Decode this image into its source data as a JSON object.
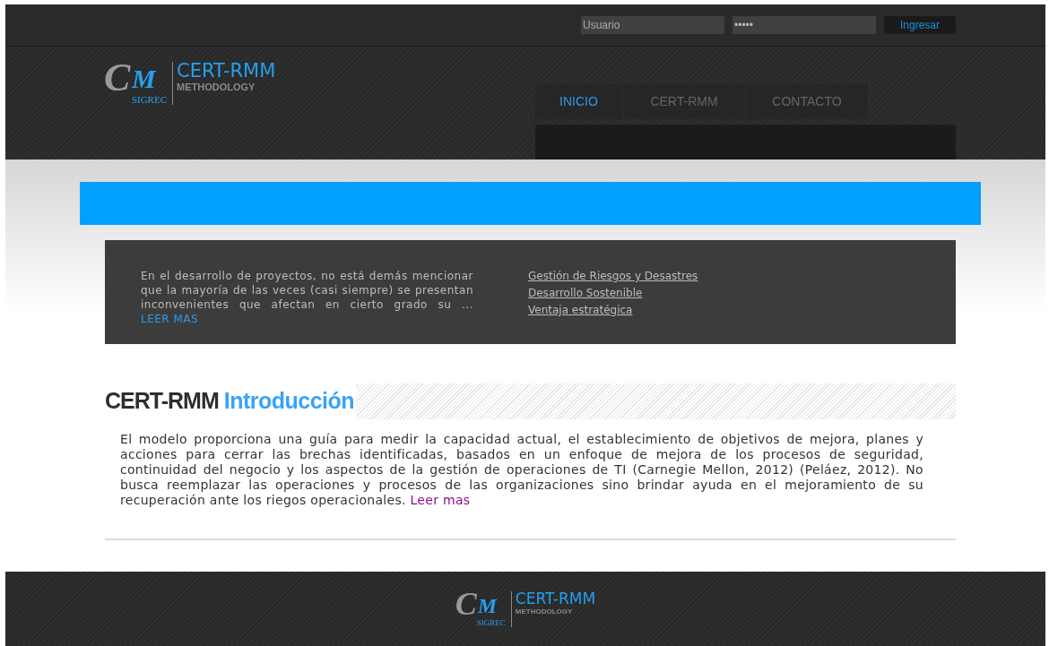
{
  "login": {
    "username_placeholder": "Usuario",
    "password": "•••••",
    "button": "Ingresar"
  },
  "header_logo": {
    "mark_c": "C",
    "mark_m": "M",
    "mark_sub": "SIGREC",
    "title": "CERT-RMM",
    "subtitle": "METHODOLOGY"
  },
  "nav": [
    {
      "label": "INICIO",
      "selected": true
    },
    {
      "label": "CERT-RMM",
      "selected": false
    },
    {
      "label": "CONTACTO",
      "selected": false
    }
  ],
  "intro_box": {
    "text": "En el desarrollo de proyectos, no está demás mencionar que la mayoría de las veces (casi siempre) se presentan inconvenientes que afectan en cierto grado su ...",
    "more_link": "LEER MAS",
    "links": [
      "Gestión de Riesgos y Desastres",
      "Desarrollo Sostenible",
      "Ventaja estratégica"
    ]
  },
  "section": {
    "title": "CERT-RMM",
    "title_highlight": "Introducción",
    "text": "El modelo proporciona una guía para medir la capacidad actual, el establecimiento de objetivos de mejora, planes y acciones para cerrar las brechas identificadas, basados en un enfoque de mejora de los procesos de seguridad, continuidad del negocio y los aspectos de la gestión de operaciones de TI (Carnegie Mellon, 2012) (Peláez, 2012). No busca reemplazar las operaciones y procesos de las organizaciones sino brindar ayuda en el mejoramiento de su recuperación ante los riegos operacionales.",
    "more_link": "Leer mas"
  },
  "footer_logo": {
    "mark_c": "C",
    "mark_m": "M",
    "mark_sub": "SIGREC",
    "title": "CERT-RMM",
    "subtitle": "METHODOLOGY"
  }
}
